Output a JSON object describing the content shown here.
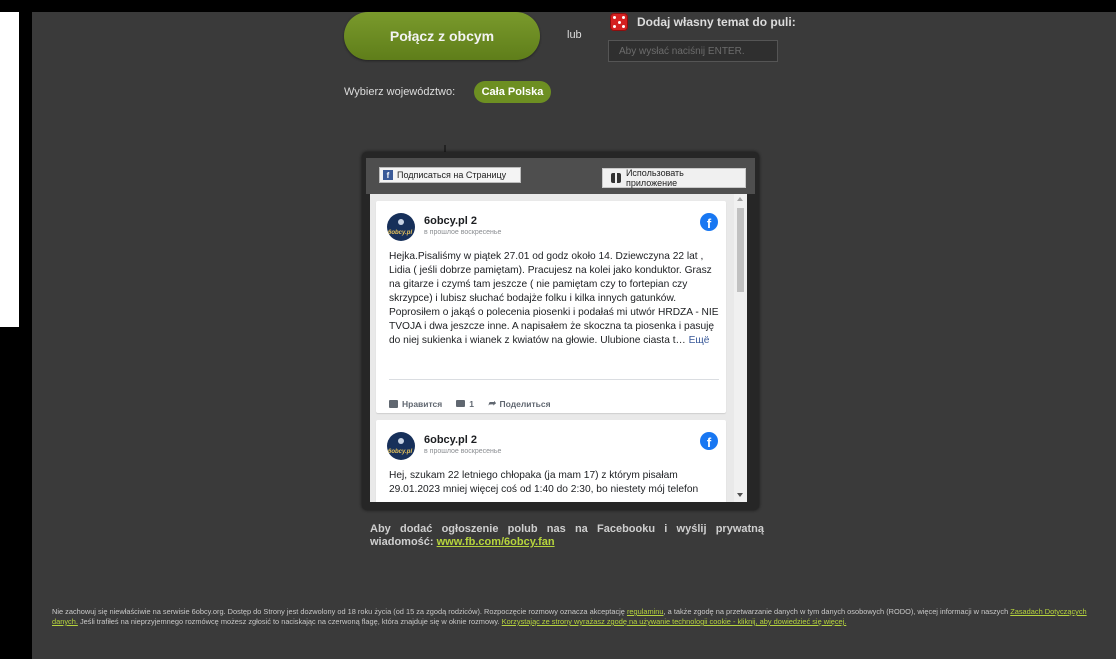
{
  "connect_button": "Połącz z obcym",
  "lub": "lub",
  "topic": {
    "label": "Dodaj własny temat do puli:",
    "placeholder": "Aby wysłać naciśnij ENTER."
  },
  "region": {
    "label": "Wybierz województwo:",
    "value": "Cała Polska"
  },
  "fb_widget": {
    "follow_label": "Подписаться на Страницу",
    "app_label": "Использовать приложение",
    "posts": [
      {
        "author": "6obcy.pl 2",
        "time": "в прошлое воскресенье",
        "avatar_text": "6obcy.pl",
        "text": "Hejka.Pisaliśmy w piątek 27.01 od godz około 14. Dziewczyna 22 lat , Lidia ( jeśli dobrze pamiętam). Pracujesz na kolei jako konduktor. Grasz na gitarze i czymś tam jeszcze ( nie pamiętam czy to fortepian czy skrzypce) i lubisz słuchać bodajże folku i kilka innych gatunków. Poprosiłem o jakąś o polecenia piosenki i podałaś mi utwór HRDZA - NIE TVOJA i dwa jeszcze inne. A napisałem że skoczna ta piosenka i pasuję do niej sukienka i wianek z kwiatów na głowie. Ulubione ciasta t…",
        "more": "Ещё",
        "like_label": "Нравится",
        "comment_count": "1",
        "share_label": "Поделиться"
      },
      {
        "author": "6obcy.pl 2",
        "time": "в прошлое воскресенье",
        "avatar_text": "6obcy.pl",
        "text": "Hej, szukam 22 letniego chłopaka (ja mam 17) z którym pisałam 29.01.2023 mniej więcej coś od 1:40 do 2:30, bo niestety mój telefon"
      }
    ]
  },
  "ad_info": {
    "text": "Aby dodać ogłoszenie polub nas na Facebooku i wyślij prywatną wiadomość: ",
    "link": "www.fb.com/6obcy.fan"
  },
  "footer": {
    "part1": "Nie zachowuj się niewłaściwie na serwisie 6obcy.org. Dostęp do Strony jest dozwolony od 18 roku życia (od 15 za zgodą rodziców). Rozpoczęcie rozmowy oznacza akceptację ",
    "link1": "regulaminu",
    "part2": ", a także zgodę na przetwarzanie danych w tym danych osobowych (RODO), więcej informacji w naszych ",
    "link2": "Zasadach Dotyczących danych.",
    "part3": " Jeśli trafiłeś na nieprzyjemnego rozmówcę możesz zgłosić to naciskając na czerwoną flagę, która znajduje się w oknie rozmowy. ",
    "link3": "Korzystając ze strony wyrażasz zgodę na używanie technologii cookie - kliknij, aby dowiedzieć się więcej."
  }
}
